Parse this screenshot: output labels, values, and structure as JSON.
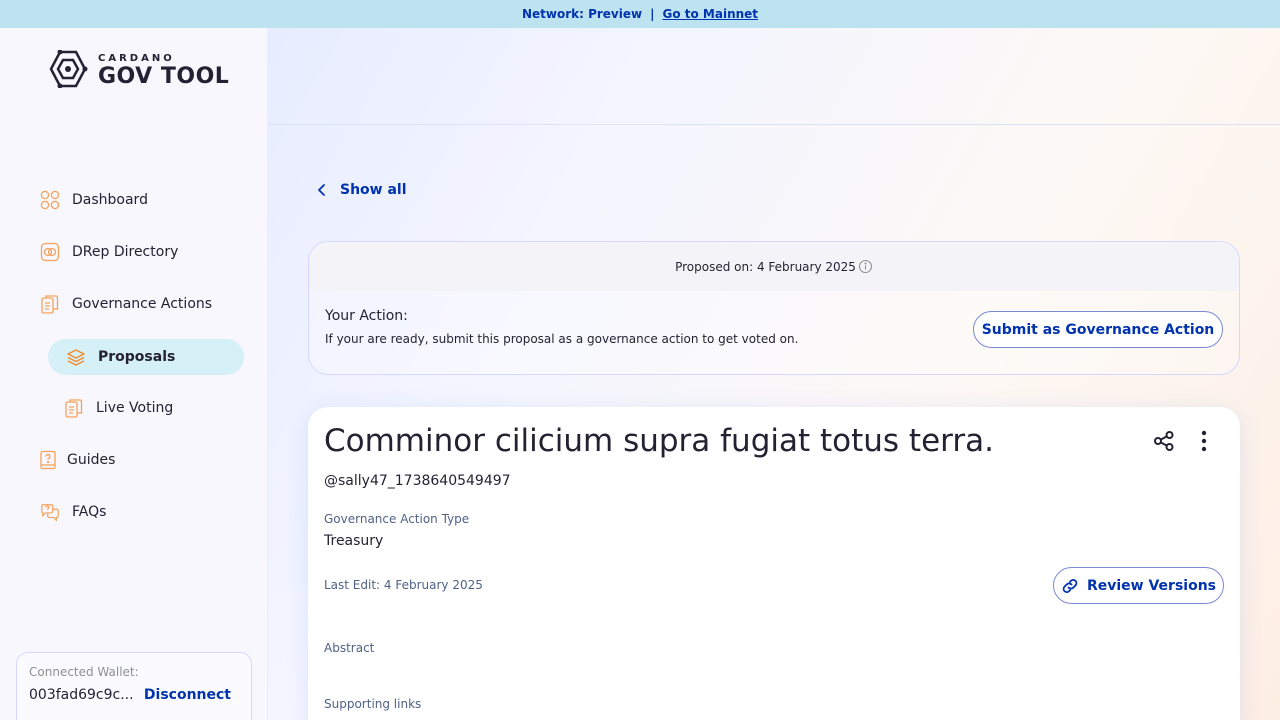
{
  "network_bar": {
    "label": "Network: Preview",
    "separator": "|",
    "link": "Go to Mainnet"
  },
  "logo": {
    "top": "CARDANO",
    "bottom": "GOV TOOL"
  },
  "sidebar": {
    "items": [
      {
        "label": "Dashboard",
        "icon": "dashboard-icon"
      },
      {
        "label": "DRep Directory",
        "icon": "drep-directory-icon"
      },
      {
        "label": "Governance Actions",
        "icon": "governance-actions-icon"
      },
      {
        "label": "Proposals",
        "icon": "proposals-icon",
        "active": true
      },
      {
        "label": "Live Voting",
        "icon": "live-voting-icon"
      },
      {
        "label": "Guides",
        "icon": "guides-icon"
      },
      {
        "label": "FAQs",
        "icon": "faqs-icon"
      }
    ]
  },
  "wallet": {
    "label": "Connected Wallet:",
    "address": "003fad69c9c...",
    "disconnect": "Disconnect"
  },
  "main": {
    "back_label": "Show all",
    "action_card": {
      "proposed_on": "Proposed on: 4 February 2025",
      "title": "Your Action:",
      "description": "If your are ready, submit this proposal as a governance action to get voted on.",
      "submit_label": "Submit as Governance Action"
    },
    "proposal": {
      "title": "Comminor cilicium supra fugiat totus terra.",
      "author": "@sally47_1738640549497",
      "type_label": "Governance Action Type",
      "type_value": "Treasury",
      "last_edit": "Last Edit: 4 February 2025",
      "review_label": "Review Versions",
      "abstract_label": "Abstract",
      "links_label": "Supporting links"
    }
  },
  "colors": {
    "primary": "#0033ad",
    "network_bar": "#bde3f0",
    "active_nav": "#d5f0f7",
    "icon_accent": "#f5a25d"
  }
}
